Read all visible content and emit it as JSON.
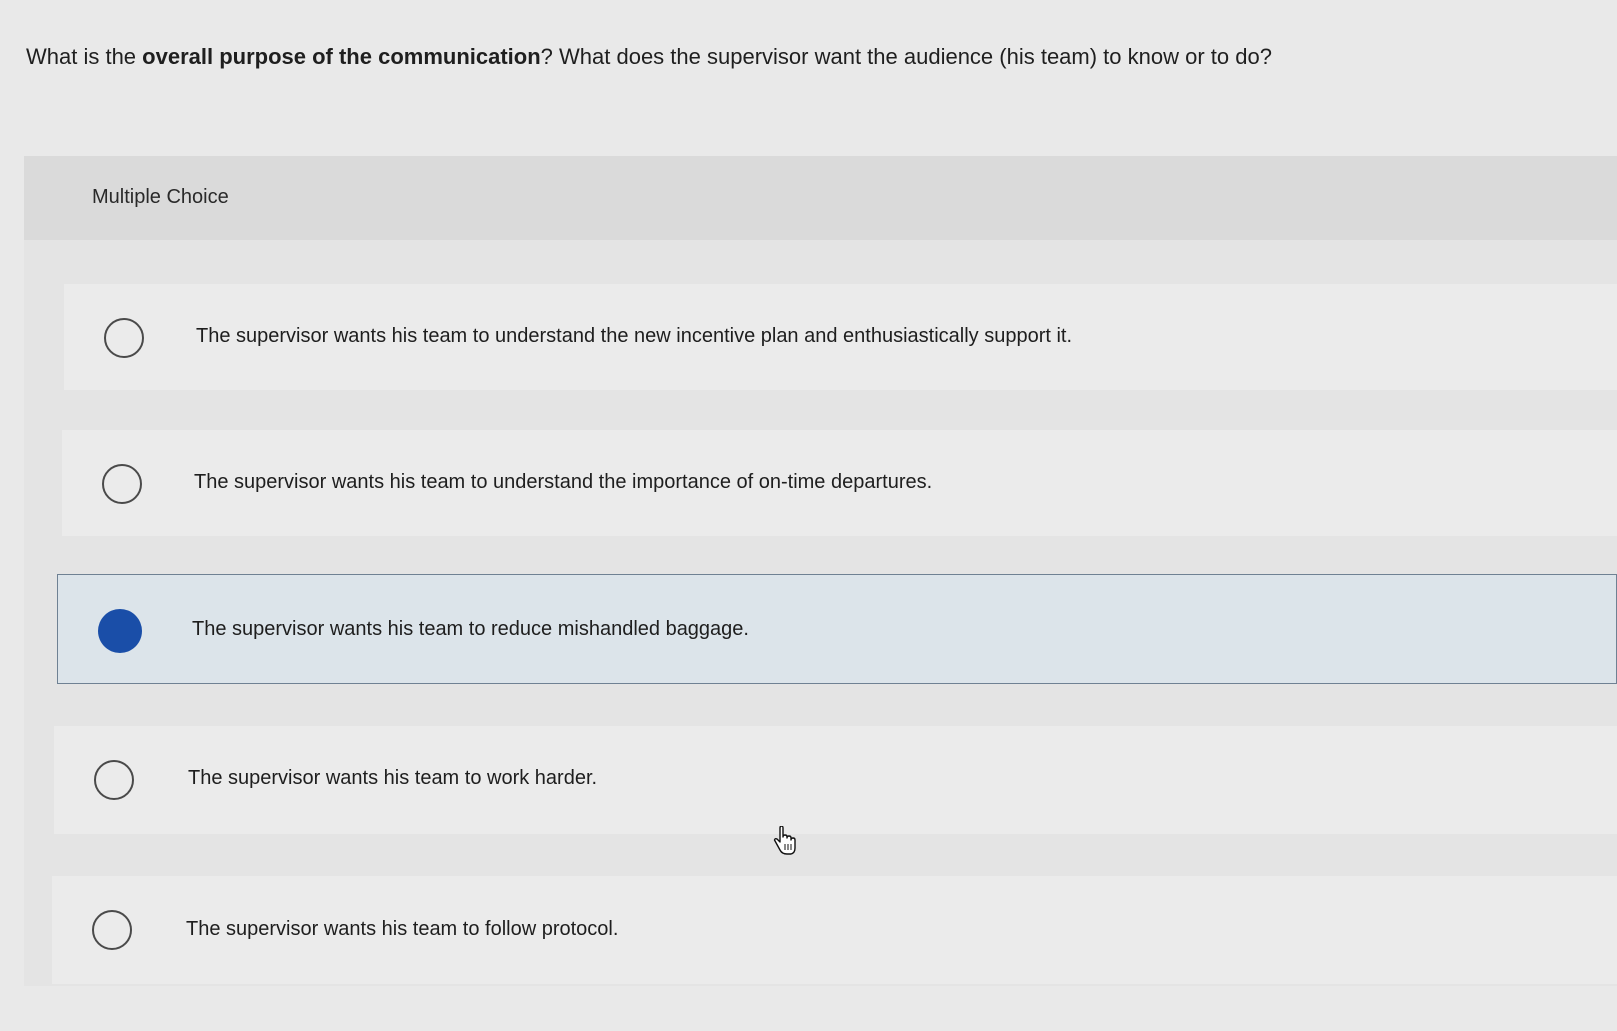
{
  "question": {
    "prefix": "What is the ",
    "emphasis": "overall purpose of the communication",
    "suffix": "? What does the supervisor want the audience (his team) to know or to do?"
  },
  "panel": {
    "label": "Multiple Choice"
  },
  "options": [
    {
      "text": "The supervisor wants his team to understand the new incentive plan and enthusiastically support it.",
      "selected": false
    },
    {
      "text": "The supervisor wants his team to understand the importance of on-time departures.",
      "selected": false
    },
    {
      "text": "The supervisor wants his team to reduce mishandled baggage.",
      "selected": true
    },
    {
      "text": "The supervisor wants his team to work harder.",
      "selected": false
    },
    {
      "text": "The supervisor wants his team to follow protocol.",
      "selected": false
    }
  ],
  "colors": {
    "selected_radio": "#1a4ea8",
    "selected_background": "#dce4ea"
  },
  "icons": {
    "cursor": "hand-pointer-icon"
  }
}
